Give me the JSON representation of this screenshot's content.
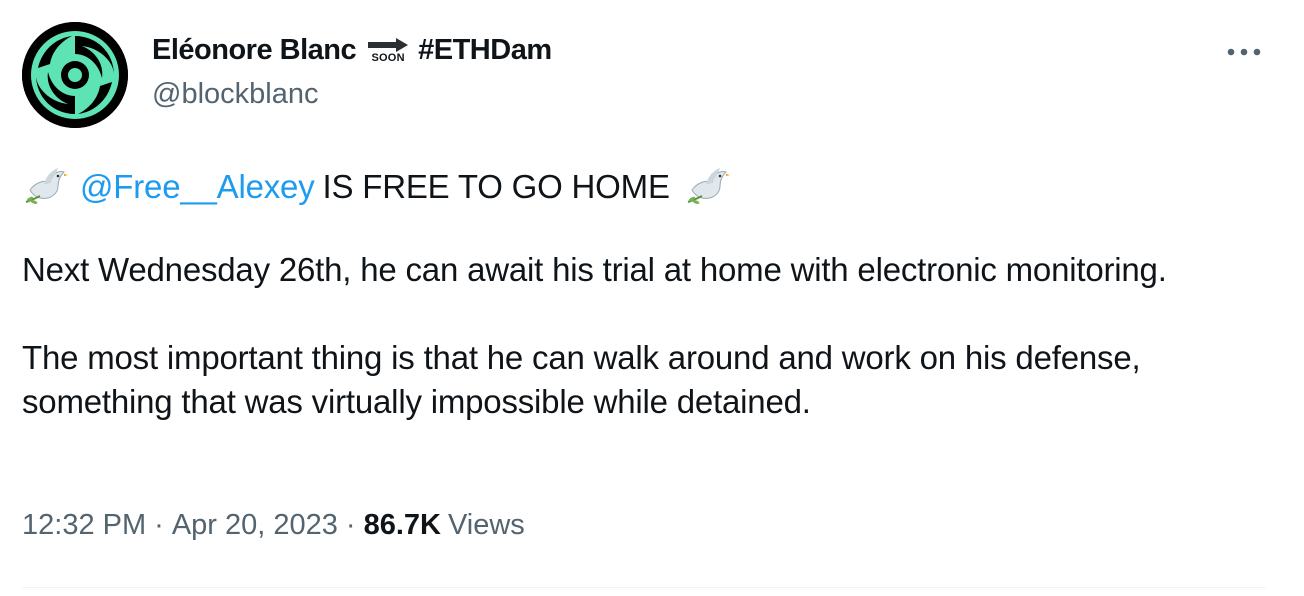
{
  "author": {
    "display_name": "Eléonore Blanc",
    "emoji_soon_label": "SOON",
    "hashtag": "#ETHDam",
    "handle": "@blockblanc"
  },
  "more_menu_icon": "more-horizontal-icon",
  "tweet": {
    "mention": "@Free__Alexey",
    "headline": "IS FREE TO GO HOME",
    "paragraph_1": "Next Wednesday 26th, he can await his trial at home with electronic monitoring.",
    "paragraph_2": "The most important thing is that he can walk around and work on his defense, something that was virtually impossible while detained."
  },
  "meta": {
    "time": "12:32 PM",
    "separator": "·",
    "date": "Apr 20, 2023",
    "views_count": "86.7K",
    "views_label": "Views"
  },
  "colors": {
    "mention_blue": "#1d9bf0",
    "secondary_text": "#536471",
    "avatar_green": "#5ee3b4",
    "divider": "#eff3f4"
  }
}
